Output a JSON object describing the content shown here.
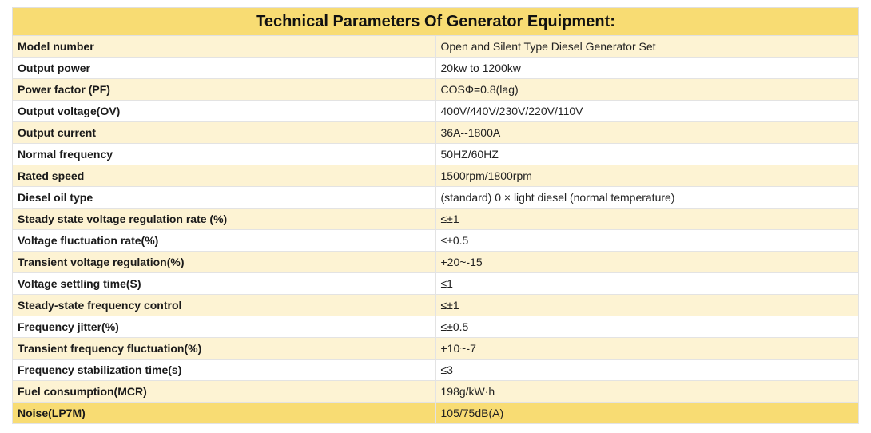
{
  "title": "Technical Parameters Of Generator Equipment:",
  "rows": [
    {
      "label": "Model number",
      "value": "Open and Silent Type Diesel Generator Set"
    },
    {
      "label": "Output power",
      "value": "20kw to 1200kw"
    },
    {
      "label": "Power factor (PF)",
      "value": "COSΦ=0.8(lag)"
    },
    {
      "label": "Output voltage(OV)",
      "value": "400V/440V/230V/220V/110V"
    },
    {
      "label": "Output current",
      "value": "36A--1800A"
    },
    {
      "label": "Normal frequency",
      "value": "50HZ/60HZ"
    },
    {
      "label": "Rated speed",
      "value": "1500rpm/1800rpm"
    },
    {
      "label": "Diesel oil type",
      "value": "(standard) 0 × light diesel (normal temperature)"
    },
    {
      "label": "Steady state voltage regulation rate (%)",
      "value": "≤±1"
    },
    {
      "label": "Voltage fluctuation rate(%)",
      "value": "≤±0.5"
    },
    {
      "label": "Transient voltage regulation(%)",
      "value": "+20~-15"
    },
    {
      "label": "Voltage settling time(S)",
      "value": "≤1"
    },
    {
      "label": "Steady-state frequency control",
      "value": "≤±1"
    },
    {
      "label": "Frequency jitter(%)",
      "value": "≤±0.5"
    },
    {
      "label": "Transient frequency fluctuation(%)",
      "value": "+10~-7"
    },
    {
      "label": "Frequency stabilization time(s)",
      "value": "≤3"
    },
    {
      "label": "Fuel consumption(MCR)",
      "value": "198g/kW·h"
    },
    {
      "label": "Noise(LP7M)",
      "value": "105/75dB(A)"
    }
  ]
}
